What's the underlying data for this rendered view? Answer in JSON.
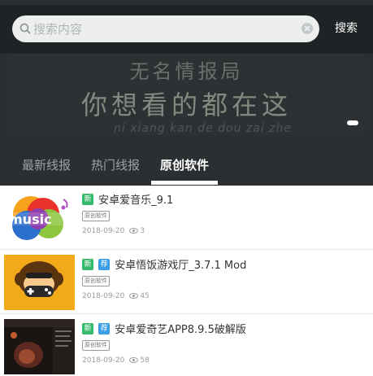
{
  "search": {
    "placeholder": "搜索内容",
    "button_label": "搜索"
  },
  "banner": {
    "line1": "无名情报局",
    "line2": "你想看的都在这",
    "line3": "ni xiang kan de dou zai zhe"
  },
  "tabs": [
    {
      "label": "最新线报",
      "active": false
    },
    {
      "label": "热门线报",
      "active": false
    },
    {
      "label": "原创软件",
      "active": true
    }
  ],
  "items": [
    {
      "badges": [
        "新"
      ],
      "title": "安卓爱音乐_9.1",
      "tag": "原创软件",
      "date": "2018-09-20",
      "views": "3",
      "thumb_icon": "imusic-logo",
      "thumb_text": "music"
    },
    {
      "badges": [
        "新",
        "荐"
      ],
      "title": "安卓悟饭游戏厅_3.7.1 Mod",
      "tag": "原创软件",
      "date": "2018-09-20",
      "views": "45",
      "thumb_icon": "monkey-gamepad-logo"
    },
    {
      "badges": [
        "新",
        "荐"
      ],
      "title": "安卓爱奇艺APP8.9.5破解版",
      "tag": "原创软件",
      "date": "2018-09-20",
      "views": "58",
      "thumb_icon": "video-screenshot"
    }
  ],
  "colors": {
    "header_bg": "#2b2f31",
    "badge_new": "#35b96b",
    "badge_rec": "#3a9ee6"
  }
}
